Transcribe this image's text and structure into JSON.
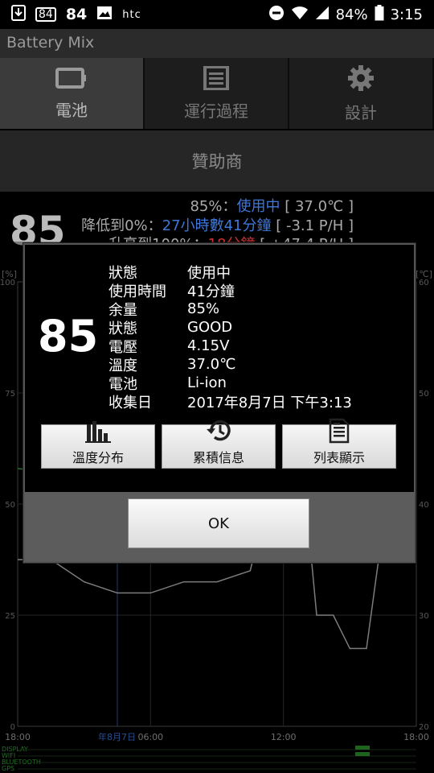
{
  "status_bar": {
    "left_badge": "84",
    "left_number": "84",
    "carrier": "htc",
    "battery_percent": "84%",
    "time": "3:15"
  },
  "app": {
    "title": "Battery Mix"
  },
  "tabs": [
    {
      "label": "電池",
      "icon": "battery-icon",
      "active": true
    },
    {
      "label": "運行過程",
      "icon": "list-icon",
      "active": false
    },
    {
      "label": "設計",
      "icon": "gear-icon",
      "active": false
    }
  ],
  "sponsor": {
    "label": "贊助商"
  },
  "info": {
    "line1": {
      "percent": "85%：",
      "state": "使用中",
      "temp": " [ 37.0℃ ]"
    },
    "line2": {
      "prefix": "降低到0%：",
      "time": "27小時數41分鐘",
      "rate": " [ -3.1 P/H ]"
    },
    "line3": {
      "prefix": "升高到100%：",
      "time": "18分鐘",
      "rate": " [ +47.4 P/H ]"
    }
  },
  "big_level": "85",
  "chart_data": {
    "type": "line",
    "left_axis": {
      "ticks": [
        "100",
        "75",
        "50",
        "25",
        "0"
      ],
      "unit": "[%]"
    },
    "right_axis": {
      "ticks": [
        "60",
        "50",
        "40",
        "30",
        "20"
      ],
      "unit": "[℃]"
    },
    "x_labels": [
      "18:00",
      "06:00",
      "12:00",
      "18:00"
    ],
    "date_marker": "年8月7日",
    "indicators": [
      "DISPLAY",
      "WIFI",
      "BLUETOOTH",
      "GPS"
    ],
    "battery_series": {
      "x": [
        0,
        2,
        4,
        6,
        8,
        10,
        12,
        14,
        16,
        18,
        20,
        21,
        22
      ],
      "y": [
        58,
        57,
        54,
        52,
        50,
        49,
        48,
        47,
        46,
        45,
        100,
        100,
        99
      ]
    },
    "temp_series": {
      "x": [
        0,
        2,
        4,
        6,
        8,
        10,
        12,
        14,
        15,
        16,
        17,
        18,
        19,
        20,
        21,
        22
      ],
      "y": [
        35,
        35,
        33,
        32,
        32,
        33,
        33,
        34,
        40,
        47,
        46,
        30,
        30,
        27,
        27,
        38
      ]
    }
  },
  "dialog": {
    "level": "85",
    "rows": [
      {
        "k": "狀態",
        "v": "使用中"
      },
      {
        "k": "使用時間",
        "v": "41分鐘"
      },
      {
        "k": "余量",
        "v": "85%"
      },
      {
        "k": "狀態",
        "v": "GOOD"
      },
      {
        "k": "電壓",
        "v": "4.15V"
      },
      {
        "k": "溫度",
        "v": "37.0℃"
      },
      {
        "k": "電池",
        "v": "Li-ion"
      },
      {
        "k": "收集日",
        "v": "2017年8月7日 下午3:13"
      }
    ],
    "buttons": [
      {
        "label": "溫度分布",
        "icon": "bar-chart-icon"
      },
      {
        "label": "累積信息",
        "icon": "history-icon"
      },
      {
        "label": "列表顯示",
        "icon": "document-list-icon"
      }
    ],
    "ok_label": "OK"
  },
  "colors": {
    "accent_blue": "#3f77d8",
    "accent_red": "#d03030",
    "chart_green": "#3aa83a"
  }
}
